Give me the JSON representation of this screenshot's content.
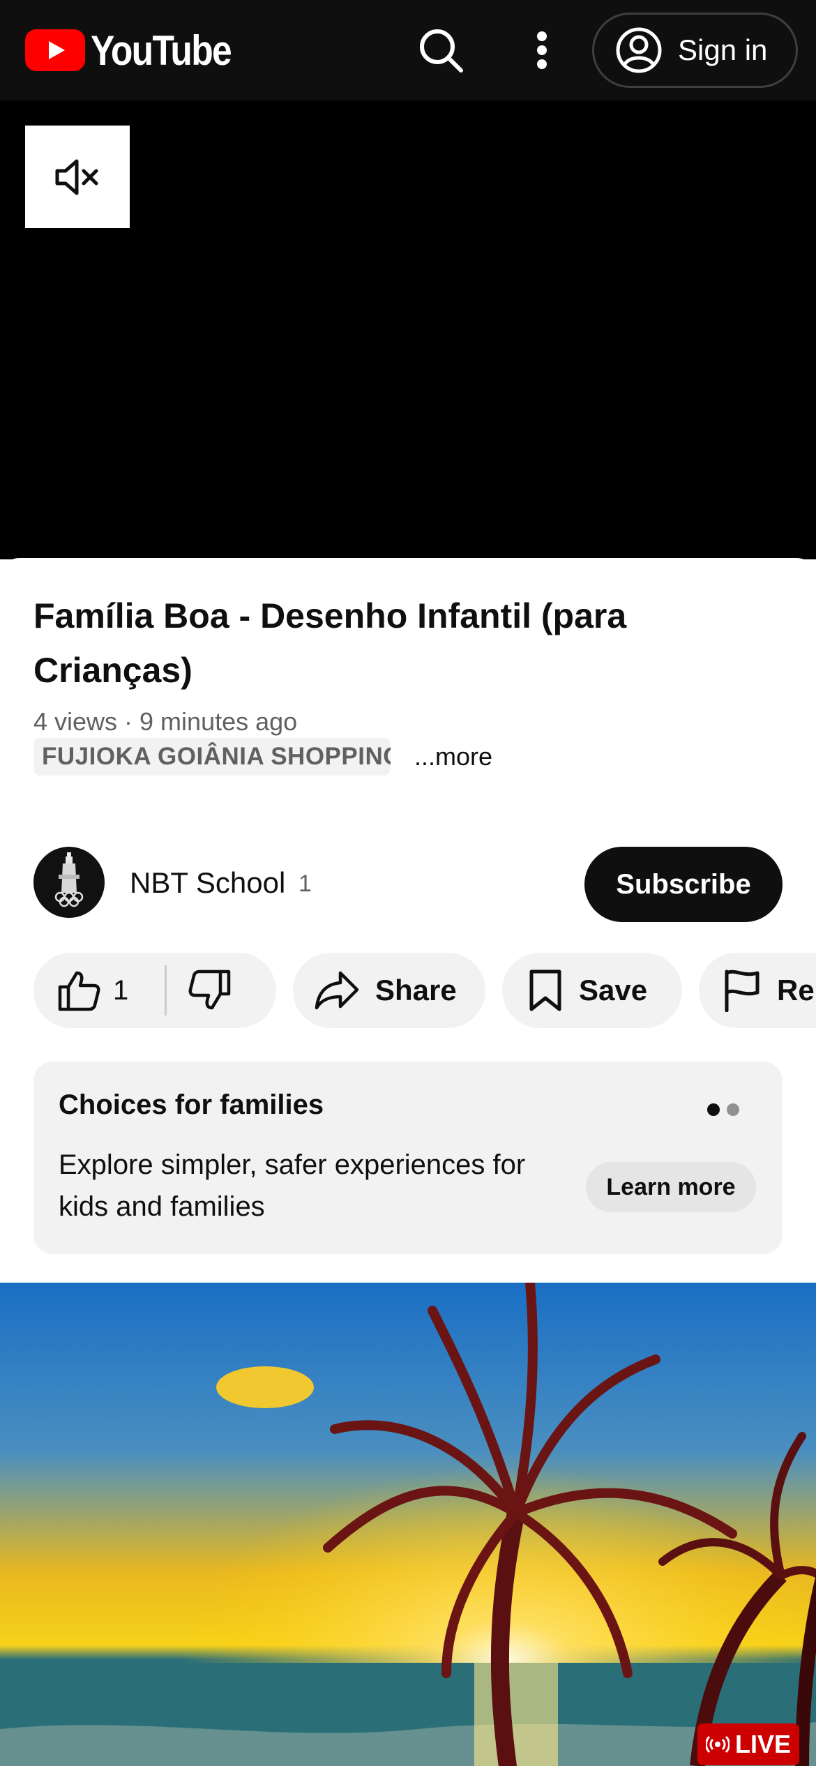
{
  "header": {
    "logo_text": "YouTube",
    "search_icon": "search-icon",
    "more_icon": "more-vert-icon",
    "signin_label": "Sign in"
  },
  "player": {
    "mute_icon": "volume-off-icon"
  },
  "video": {
    "title": "Família Boa - Desenho Infantil (para Crianças)",
    "meta": "4 views · 9 minutes ago",
    "location": "FUJIOKA GOIÂNIA SHOPPING",
    "more_label": "...more"
  },
  "channel": {
    "name": "NBT School",
    "subscribers": "1",
    "subscribe_label": "Subscribe"
  },
  "actions": {
    "like_count": "1",
    "share_label": "Share",
    "save_label": "Save",
    "report_label": "Re"
  },
  "promo_card": {
    "title": "Choices for families",
    "body": "Explore simpler, safer experiences for kids and families",
    "button_label": "Learn more",
    "page_count": 2,
    "active_page": 1
  },
  "next_video": {
    "badge_label": "LIVE"
  },
  "colors": {
    "brand_red": "#ff0000",
    "live_red": "#cc0000",
    "header_bg": "#0f0f0f"
  }
}
